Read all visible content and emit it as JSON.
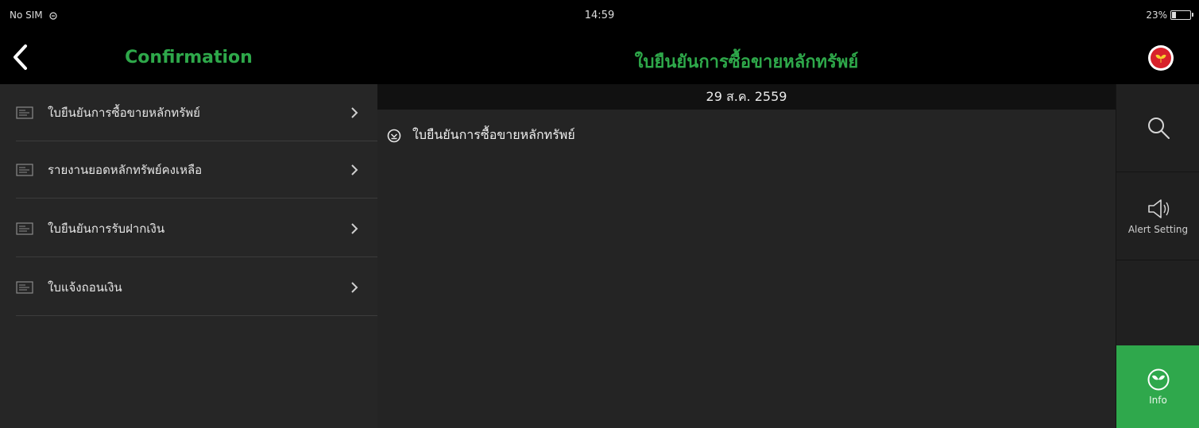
{
  "status_bar": {
    "carrier": "No SIM",
    "time": "14:59",
    "battery_percent_text": "23%",
    "battery_level": 0.23
  },
  "nav": {
    "left_title": "Confirmation",
    "center_title": "ใบยืนยันการซื้อขายหลักทรัพย์",
    "back_icon": "chevron-left-icon",
    "logo_icon": "kasikorn-logo-icon"
  },
  "sidebar": {
    "items": [
      {
        "label": "ใบยืนยันการซื้อขายหลักทรัพย์",
        "icon": "document-icon"
      },
      {
        "label": "รายงานยอดหลักทรัพย์คงเหลือ",
        "icon": "document-icon"
      },
      {
        "label": "ใบยืนยันการรับฝากเงิน",
        "icon": "document-icon"
      },
      {
        "label": "ใบแจ้งถอนเงิน",
        "icon": "document-icon"
      }
    ]
  },
  "main": {
    "date": "29 ส.ค. 2559",
    "documents": [
      {
        "label": "ใบยืนยันการซื้อขายหลักทรัพย์",
        "icon": "download-circle-icon"
      }
    ]
  },
  "rail": {
    "search_icon": "search-icon",
    "alert_label": "Alert Setting",
    "info_label": "Info"
  },
  "colors": {
    "accent": "#2ea84a",
    "info_button_bg": "#2fa84c",
    "sidebar_bg": "#262626",
    "main_bg": "#242424",
    "bar_bg": "#000000"
  }
}
